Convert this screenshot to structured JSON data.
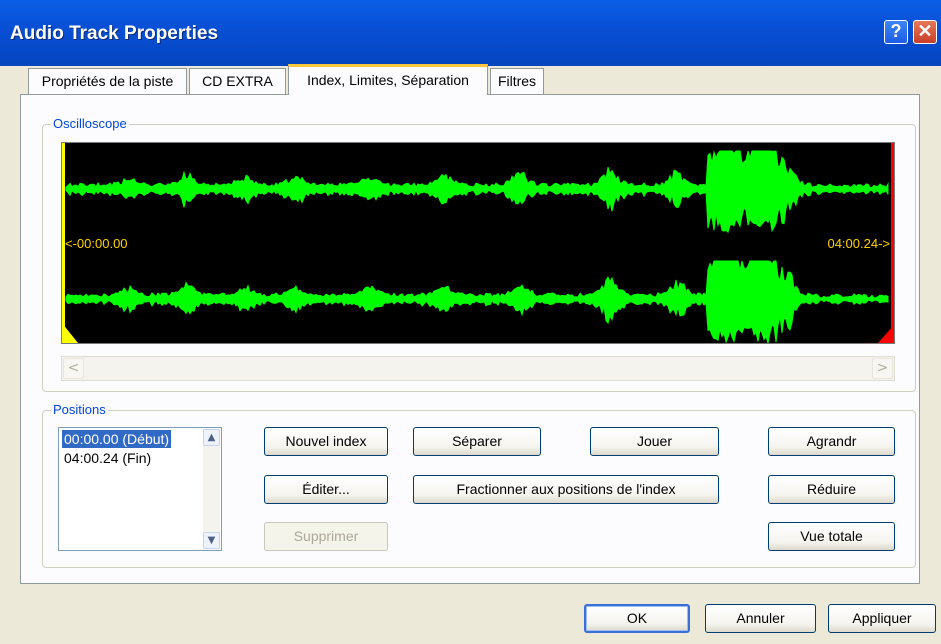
{
  "window": {
    "title": "Audio Track Properties",
    "help_glyph": "?",
    "close_glyph": "✕"
  },
  "tabs": [
    {
      "label": "Propriétés de la piste"
    },
    {
      "label": "CD EXTRA"
    },
    {
      "label": "Index, Limites, Séparation",
      "active": true
    },
    {
      "label": "Filtres"
    }
  ],
  "oscilloscope": {
    "group_label": "Oscilloscope",
    "start_time": "<-00:00.00",
    "end_time": "04:00.24->",
    "wave_color": "#00ff00",
    "start_marker_color": "#ffff00",
    "end_marker_color": "#ff0000",
    "scroll_left_glyph": "<",
    "scroll_right_glyph": ">"
  },
  "positions": {
    "group_label": "Positions",
    "items": [
      {
        "label": "00:00.00 (Début)",
        "selected": true
      },
      {
        "label": "04:00.24 (Fin)",
        "selected": false
      }
    ]
  },
  "buttons": {
    "new_index": "Nouvel index",
    "edit": "Éditer...",
    "delete": "Supprimer",
    "split": "Séparer",
    "split_at_index": "Fractionner aux positions de l'index",
    "play": "Jouer",
    "zoom_in": "Agrandr",
    "zoom_out": "Réduire",
    "full_view": "Vue totale",
    "ok": "OK",
    "cancel": "Annuler",
    "apply": "Appliquer"
  }
}
